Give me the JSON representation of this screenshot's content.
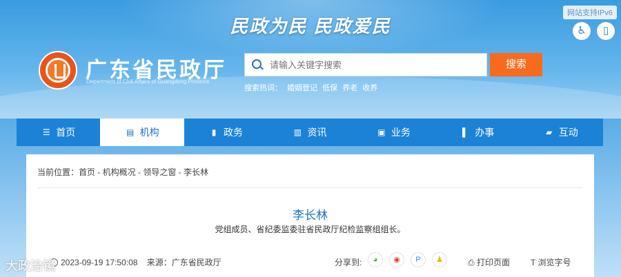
{
  "banner": {
    "slogan": "民政为民  民政爱民",
    "ipv6_label": "网站支持IPv6",
    "accessibility_icon": "accessibility-icon",
    "mobile_icon": "mobile-icon"
  },
  "logo": {
    "name": "广东省民政厅",
    "english_name": "Department of Civil Affairs of Guangdong Province"
  },
  "search": {
    "placeholder": "请输入关键字搜索",
    "button_label": "搜索",
    "hot_label": "搜索热词：",
    "hot_terms": [
      "婚姻登记",
      "低保",
      "养老",
      "收养"
    ]
  },
  "nav": {
    "items": [
      {
        "label": "首页",
        "icon": "☰"
      },
      {
        "label": "机构",
        "icon": "▤"
      },
      {
        "label": "政务",
        "icon": "▮"
      },
      {
        "label": "资讯",
        "icon": "▥"
      },
      {
        "label": "业务",
        "icon": "▣"
      },
      {
        "label": "办事",
        "icon": "▌"
      },
      {
        "label": "互动",
        "icon": "▰"
      }
    ],
    "active_index": 1
  },
  "breadcrumb": "当前位置：首页 - 机构概况 - 领导之窗 - 李长林",
  "article": {
    "title": "李长林",
    "subtitle": "党组成员、省纪委监委驻省民政厅纪检监察组组长。",
    "date": "2023-09-19 17:50:08",
    "source": "来源：广东省民政厅",
    "share_label": "分享到:",
    "print_label": "打印页面",
    "font_label": "浏览字号"
  },
  "colors": {
    "primary": "#1c82d6",
    "accent": "#f86b1d",
    "logo": "#e8551c"
  },
  "watermark": "大政治镜"
}
